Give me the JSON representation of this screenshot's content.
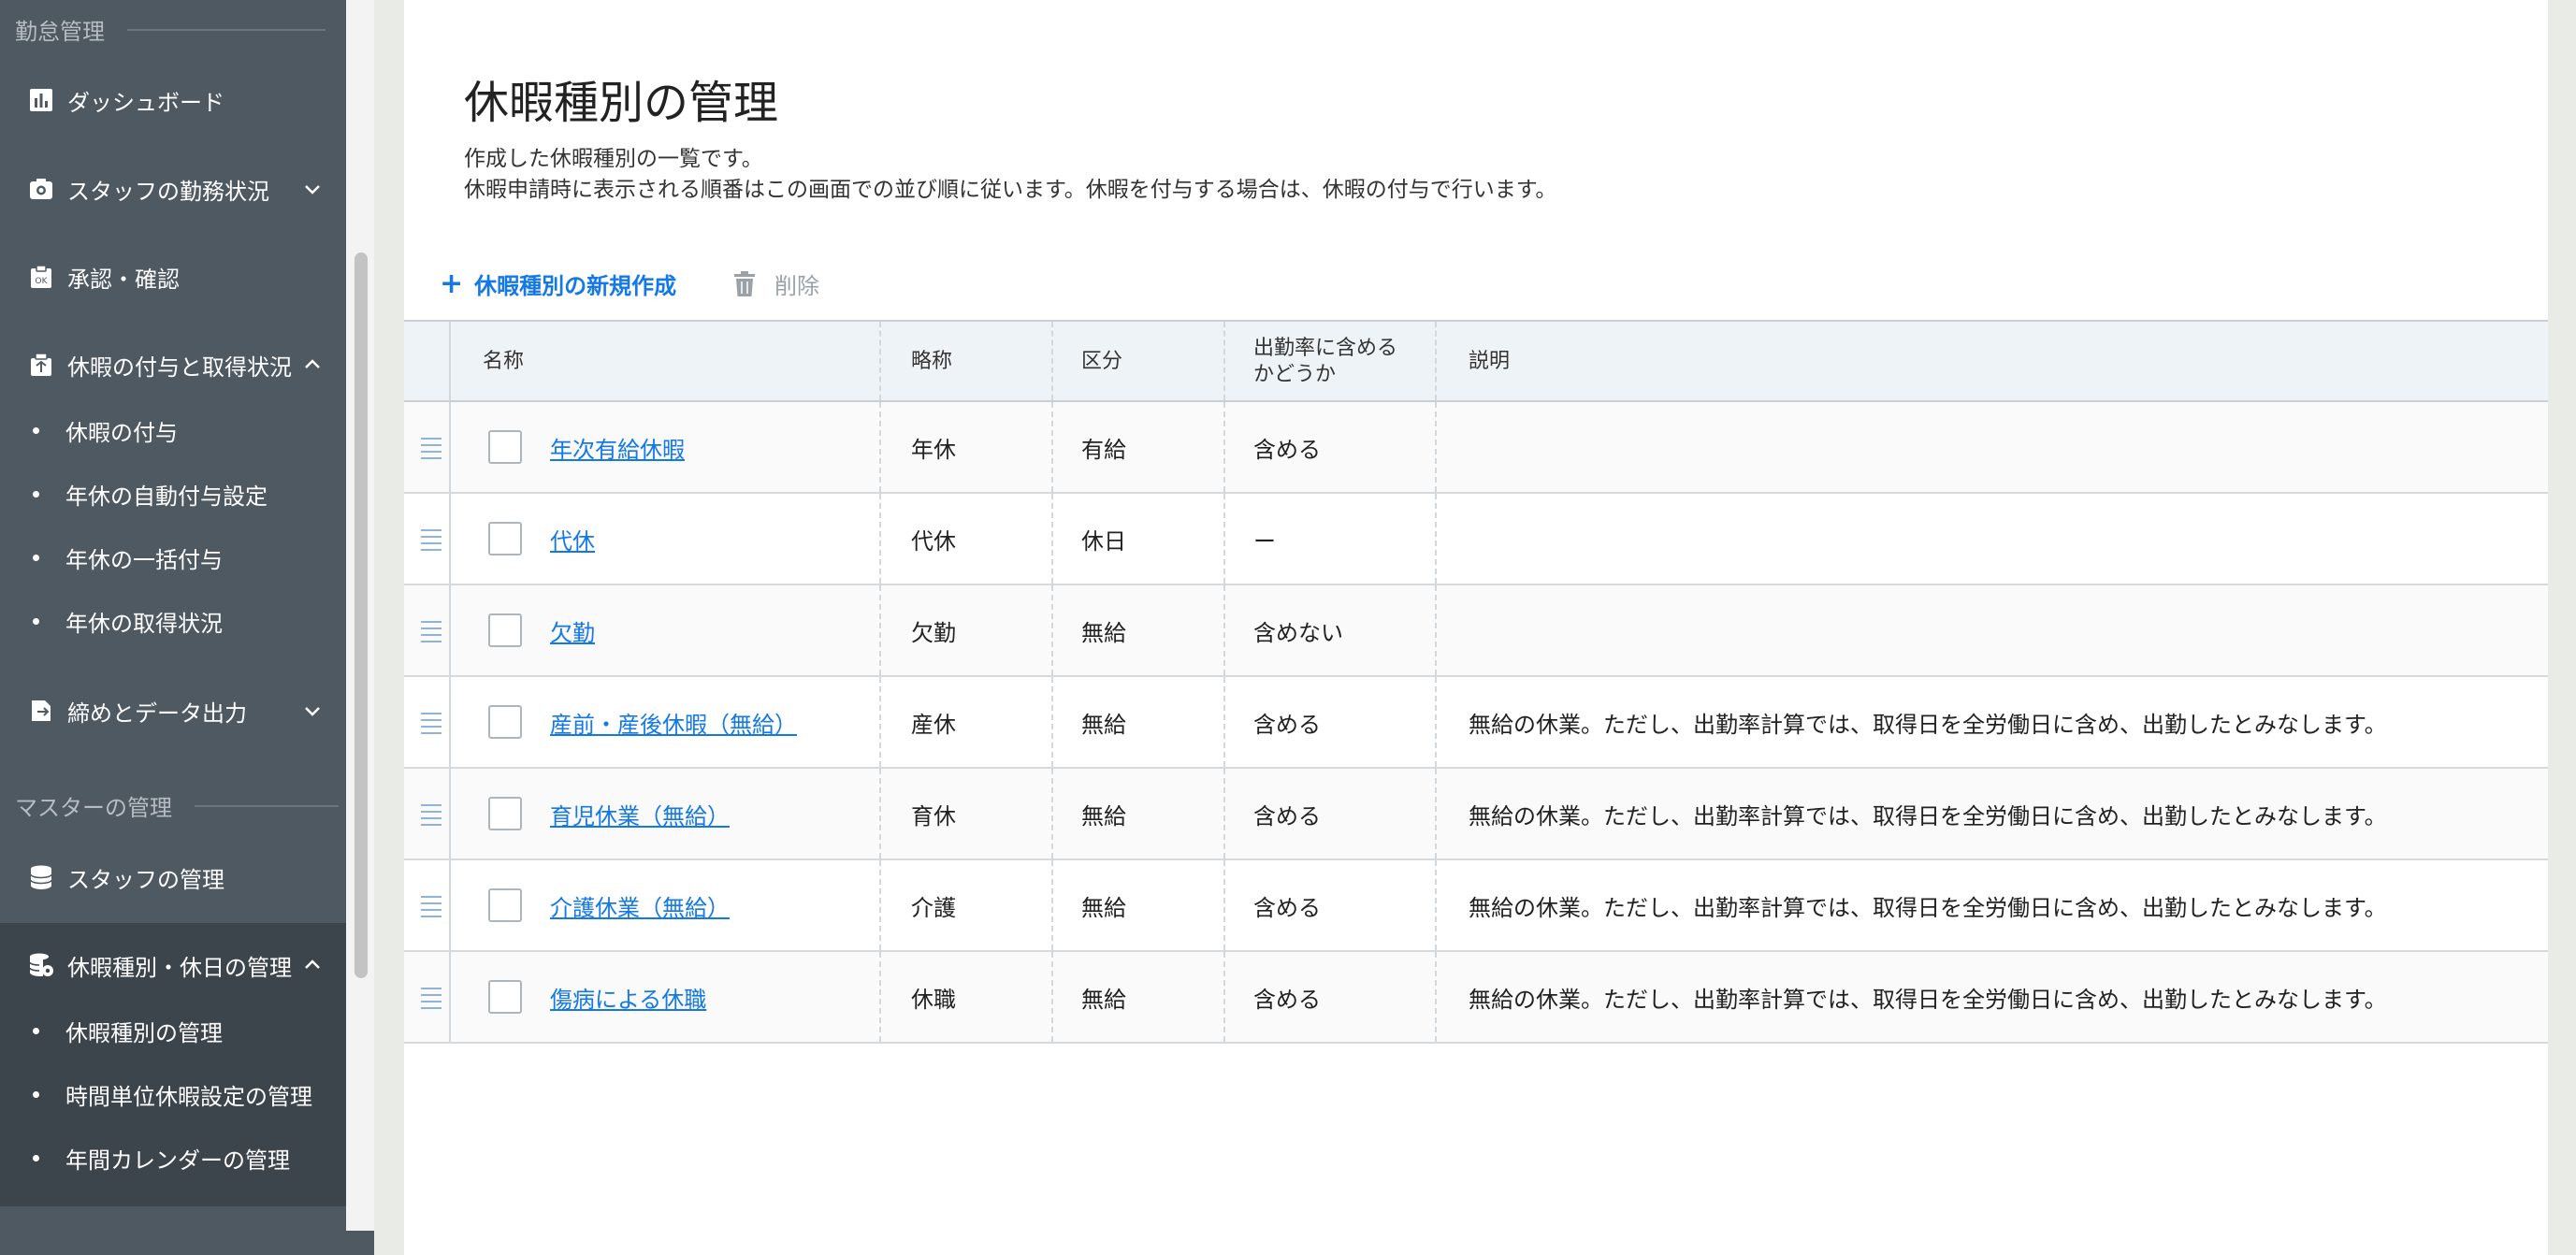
{
  "sidebar": {
    "section_attendance": "勤怠管理",
    "section_master": "マスターの管理",
    "items": [
      {
        "label": "ダッシュボード",
        "icon": "chart-icon"
      },
      {
        "label": "スタッフの勤務状況",
        "icon": "camera-icon",
        "expanded": false
      },
      {
        "label": "承認・確認",
        "icon": "approval-icon"
      },
      {
        "label": "休暇の付与と取得状況",
        "icon": "gift-icon",
        "expanded": true
      },
      {
        "label": "締めとデータ出力",
        "icon": "export-icon",
        "expanded": false
      },
      {
        "label": "スタッフの管理",
        "icon": "database-icon"
      },
      {
        "label": "休暇種別・休日の管理",
        "icon": "database-settings-icon",
        "expanded": true
      }
    ],
    "leave_sub": [
      "休暇の付与",
      "年休の自動付与設定",
      "年休の一括付与",
      "年休の取得状況"
    ],
    "master_sub": [
      "休暇種別の管理",
      "時間単位休暇設定の管理",
      "年間カレンダーの管理"
    ]
  },
  "main": {
    "title": "休暇種別の管理",
    "desc_line1": "作成した休暇種別の一覧です。",
    "desc_line2": "休暇申請時に表示される順番はこの画面での並び順に従います。休暇を付与する場合は、休暇の付与で行います。",
    "new_button": "休暇種別の新規作成",
    "delete_button": "削除",
    "columns": {
      "name": "名称",
      "abbr": "略称",
      "category": "区分",
      "attendance_rate_1": "出勤率に含める",
      "attendance_rate_2": "かどうか",
      "description": "説明"
    },
    "rows": [
      {
        "name": "年次有給休暇",
        "abbr": "年休",
        "category": "有給",
        "rate": "含める",
        "desc": ""
      },
      {
        "name": "代休",
        "abbr": "代休",
        "category": "休日",
        "rate": "ー",
        "desc": ""
      },
      {
        "name": "欠勤",
        "abbr": "欠勤",
        "category": "無給",
        "rate": "含めない",
        "desc": ""
      },
      {
        "name": "産前・産後休暇（無給）",
        "abbr": "産休",
        "category": "無給",
        "rate": "含める",
        "desc": "無給の休業。ただし、出勤率計算では、取得日を全労働日に含め、出勤したとみなします。"
      },
      {
        "name": "育児休業（無給）",
        "abbr": "育休",
        "category": "無給",
        "rate": "含める",
        "desc": "無給の休業。ただし、出勤率計算では、取得日を全労働日に含め、出勤したとみなします。"
      },
      {
        "name": "介護休業（無給）",
        "abbr": "介護",
        "category": "無給",
        "rate": "含める",
        "desc": "無給の休業。ただし、出勤率計算では、取得日を全労働日に含め、出勤したとみなします。"
      },
      {
        "name": "傷病による休職",
        "abbr": "休職",
        "category": "無給",
        "rate": "含める",
        "desc": "無給の休業。ただし、出勤率計算では、取得日を全労働日に含め、出勤したとみなします。"
      }
    ]
  },
  "colors": {
    "sidebar_bg": "#4f5962",
    "sidebar_active_bg": "#3d454c",
    "link": "#1478e6",
    "header_bg": "#eef3f7"
  }
}
